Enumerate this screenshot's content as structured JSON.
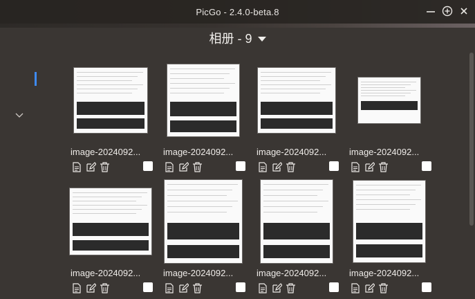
{
  "window": {
    "title": "PicGo - 2.4.0-beta.8"
  },
  "header": {
    "title": "相册 - 9"
  },
  "images": [
    {
      "name": "image-2024092...",
      "selected": false
    },
    {
      "name": "image-2024092...",
      "selected": false
    },
    {
      "name": "image-2024092...",
      "selected": false
    },
    {
      "name": "image-2024092...",
      "selected": false
    },
    {
      "name": "image-2024092...",
      "selected": false
    },
    {
      "name": "image-2024092...",
      "selected": false
    },
    {
      "name": "image-2024092...",
      "selected": false
    },
    {
      "name": "image-2024092...",
      "selected": false
    }
  ],
  "icons": {
    "copy": "document-icon",
    "edit": "edit-icon",
    "delete": "trash-icon"
  },
  "colors": {
    "background": "#3a3633",
    "accent": "#3e8bf5",
    "text": "#eeebe8"
  }
}
